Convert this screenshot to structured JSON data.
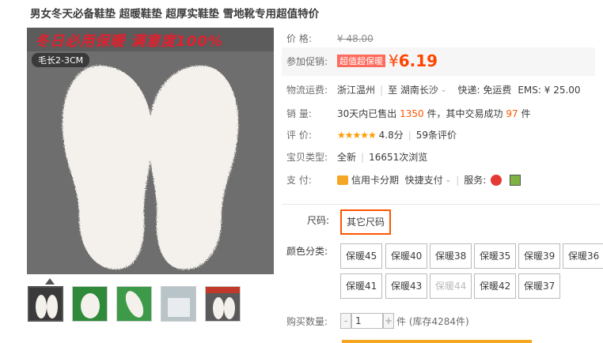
{
  "title": "男女冬天必备鞋垫 超暖鞋垫 超厚实鞋垫 雪地靴专用超值特价",
  "image": {
    "slogan": "冬日必用保暖 满意度100%",
    "fur_tag": "毛长2-3CM"
  },
  "price": {
    "label": "价    格:",
    "original": "¥ 48.00"
  },
  "promo": {
    "label": "参加促销:",
    "tag": "超值超保暖",
    "symbol": "¥",
    "value": "6.19"
  },
  "shipping": {
    "label": "物流运费:",
    "from": "浙江温州",
    "to_prefix": "至",
    "to": "湖南长沙",
    "express": "快递: 免运费",
    "ems": "EMS: ¥ 25.00"
  },
  "sales": {
    "label": "销    量:",
    "prefix": "30天内已售出",
    "count": "1350",
    "mid": "件，其中交易成功",
    "success": "97",
    "suffix": "件"
  },
  "rating": {
    "label": "评    价:",
    "stars": "★★★★★",
    "score": "4.8分",
    "reviews": "59条评价"
  },
  "product_type": {
    "label": "宝贝类型:",
    "value": "全新",
    "views": "16651次浏览"
  },
  "payment": {
    "label": "支    付:",
    "credit": "信用卡分期",
    "quick": "快捷支付",
    "service": "服务:"
  },
  "size": {
    "label": "尺码:",
    "option": "其它尺码"
  },
  "color": {
    "label": "颜色分类:",
    "options": [
      "保暖45",
      "保暖40",
      "保暖38",
      "保暖35",
      "保暖39",
      "保暖36",
      "保暖41",
      "保暖43",
      "保暖44",
      "保暖42",
      "保暖37"
    ]
  },
  "quantity": {
    "label": "购买数量:",
    "value": "1",
    "stock": "件 (库存4284件)",
    "minus": "-",
    "plus": "+"
  },
  "colors": {
    "accent": "#ff4400",
    "promo_tag": "#ff6a5c",
    "selected_border": "#ff5500"
  }
}
